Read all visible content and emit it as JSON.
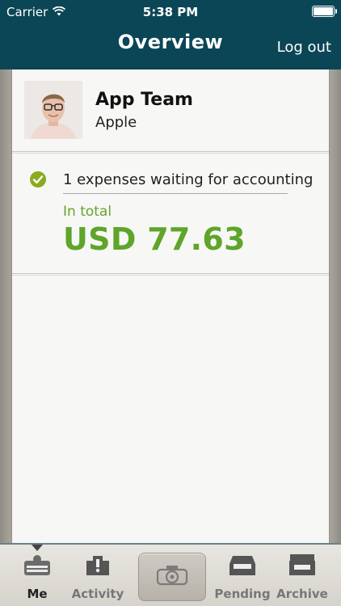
{
  "status_bar": {
    "carrier": "Carrier",
    "time": "5:38 PM"
  },
  "nav": {
    "title": "Overview",
    "logout_label": "Log out"
  },
  "profile": {
    "name": "App Team",
    "organization": "Apple"
  },
  "expenses": {
    "waiting_text": "1 expenses waiting for accounting",
    "total_label": "In total",
    "total_amount": "USD 77.63"
  },
  "tabs": [
    {
      "label": "Me",
      "icon": "me-icon",
      "active": true
    },
    {
      "label": "Activity",
      "icon": "activity-icon",
      "active": false
    },
    {
      "label": "",
      "icon": "camera-icon",
      "active": false
    },
    {
      "label": "Pending",
      "icon": "pending-icon",
      "active": false
    },
    {
      "label": "Archive",
      "icon": "archive-icon",
      "active": false
    }
  ],
  "colors": {
    "header": "#0b4656",
    "accent_green": "#5ea52a",
    "check_green": "#8aaa1f"
  }
}
